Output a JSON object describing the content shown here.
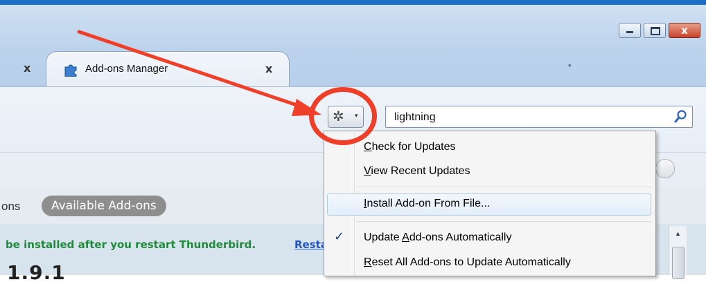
{
  "tabs": {
    "left_close": "x",
    "active": {
      "title": "Add-ons Manager",
      "close": "x"
    },
    "overflow": "▾"
  },
  "window_controls": {
    "minimize": "",
    "maximize": "",
    "close": "x"
  },
  "toolbar": {
    "gear_icon": "gear-icon",
    "gear_glyph": "✲",
    "caret": "▾",
    "search_value": "lightning"
  },
  "menu": {
    "items": [
      {
        "accel": "C",
        "rest": "heck for Updates"
      },
      {
        "accel": "V",
        "rest": "iew Recent Updates"
      },
      {
        "accel": "I",
        "rest": "nstall Add-on From File...",
        "highlighted": true
      },
      {
        "pre": "Update ",
        "accel": "A",
        "rest": "dd-ons Automatically",
        "checked": true,
        "check": "✓"
      },
      {
        "accel": "R",
        "rest": "eset All Add-ons to Update Automatically"
      }
    ]
  },
  "content": {
    "frag_left": "ons",
    "available_addons": "Available Add-ons",
    "notice": "be installed after you restart Thunderbird.",
    "notice_link": "Resta",
    "version": "1.9.1"
  },
  "colors": {
    "annotation": "#f03f28",
    "accent": "#1c6fc4",
    "notice_green": "#1f8a3a"
  }
}
